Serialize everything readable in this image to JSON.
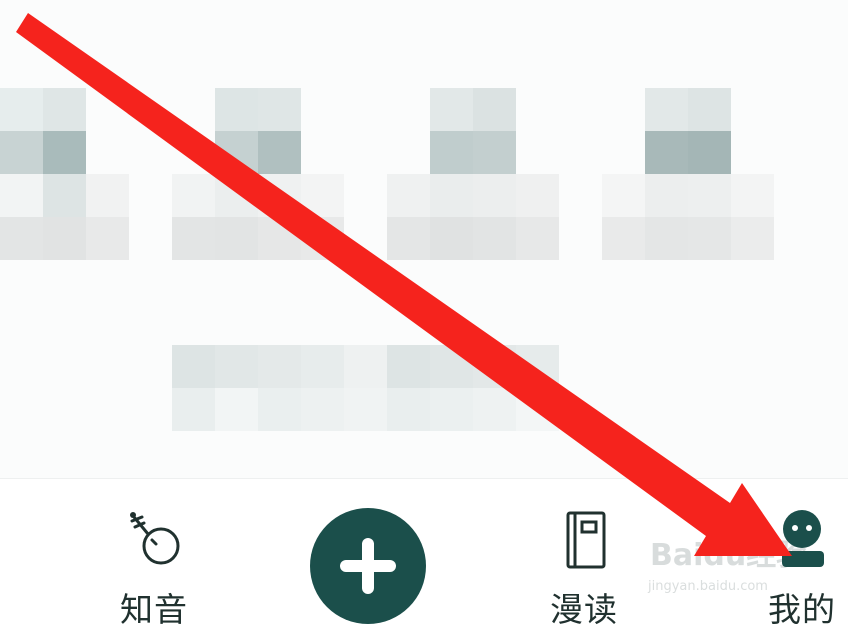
{
  "tabs": [
    {
      "id": "zhiyin",
      "label": "知音",
      "icon": "pipa-instrument-icon"
    },
    {
      "id": "add",
      "label": "",
      "icon": "plus-icon"
    },
    {
      "id": "mandu",
      "label": "漫读",
      "icon": "notebook-icon"
    },
    {
      "id": "wode",
      "label": "我的",
      "icon": "user-avatar-icon"
    }
  ],
  "watermark": {
    "brand": "Baidu经验",
    "url": "jingyan.baidu.com"
  },
  "colors": {
    "accent": "#1b4f4b",
    "arrow": "#f5231d",
    "label": "#20312f"
  }
}
